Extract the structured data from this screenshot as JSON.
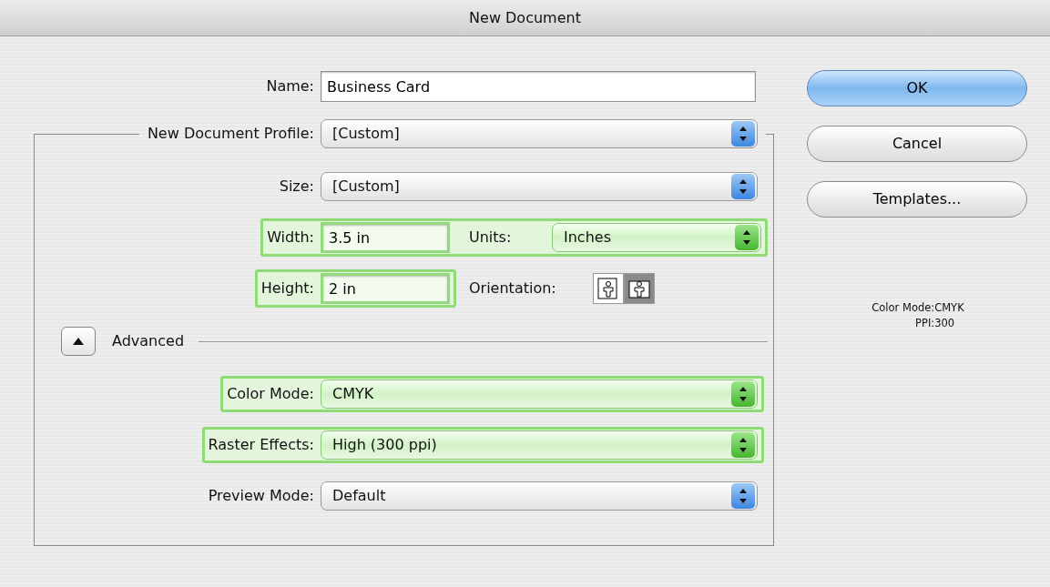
{
  "window": {
    "title": "New Document"
  },
  "name": {
    "label": "Name:",
    "value": "Business Card"
  },
  "profile": {
    "label": "New Document Profile:",
    "value": "[Custom]",
    "highlighted": false
  },
  "size": {
    "label": "Size:",
    "value": "[Custom]",
    "highlighted": false
  },
  "width_row": {
    "highlighted": true,
    "width": {
      "label": "Width:",
      "value": "3.5 in"
    },
    "units": {
      "label": "Units:",
      "value": "Inches"
    }
  },
  "height_row": {
    "highlighted": true,
    "height": {
      "label": "Height:",
      "value": "2 in"
    },
    "orientation": {
      "label": "Orientation:",
      "options": [
        {
          "kind": "portrait",
          "selected": false
        },
        {
          "kind": "landscape",
          "selected": true
        }
      ]
    }
  },
  "advanced": {
    "label": "Advanced",
    "expanded": true
  },
  "advanced_fields": [
    {
      "label": "Color Mode:",
      "value": "CMYK",
      "highlighted": true
    },
    {
      "label": "Raster Effects:",
      "value": "High (300 ppi)",
      "highlighted": true
    },
    {
      "label": "Preview Mode:",
      "value": "Default",
      "highlighted": false
    }
  ],
  "buttons": [
    {
      "label": "OK",
      "default": true
    },
    {
      "label": "Cancel",
      "default": false
    },
    {
      "label": "Templates...",
      "default": false
    }
  ],
  "summary": [
    {
      "label": "Color Mode:",
      "value": "CMYK"
    },
    {
      "label": "PPI:",
      "value": "300"
    }
  ]
}
